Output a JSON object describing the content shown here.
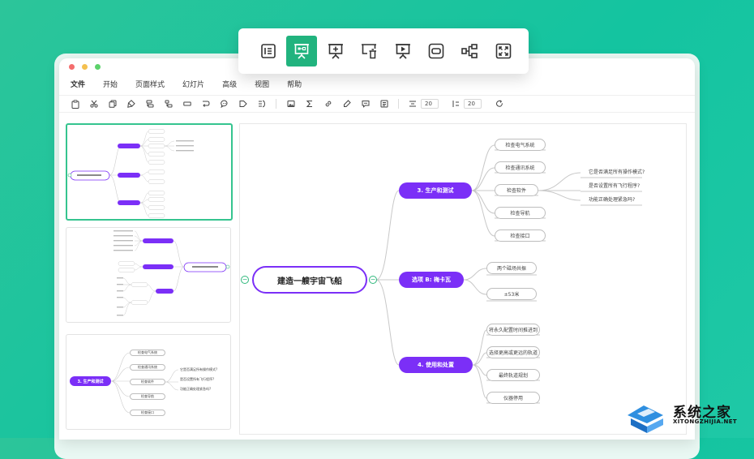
{
  "menu": [
    "文件",
    "开始",
    "页面样式",
    "幻灯片",
    "高级",
    "视图",
    "帮助"
  ],
  "toolbar": {
    "icons": [
      "clipboard-icon",
      "scissors-icon",
      "copy-icon",
      "format-brush-icon",
      "insert-subtopic-icon",
      "insert-topic-icon",
      "boundary-icon",
      "relationship-icon",
      "callout-icon",
      "tag-icon",
      "summary-icon",
      "image-icon",
      "formula-icon",
      "link-icon",
      "highlighter-icon",
      "comment-icon",
      "outline-icon"
    ],
    "spacing_h": "20",
    "spacing_v": "20"
  },
  "floating_toolbar": {
    "icons": [
      "outline-view-icon",
      "presentation-icon",
      "add-slide-icon",
      "delete-slide-icon",
      "play-slideshow-icon",
      "fit-slide-icon",
      "branch-slide-icon",
      "fullscreen-icon"
    ],
    "active_index": 1
  },
  "mindmap": {
    "root": "建造一艘宇宙飞船",
    "branches": [
      {
        "title": "3. 生产和测试",
        "children": [
          "检查电气系统",
          "检查通讯系统",
          "检查软件",
          "检查导航",
          "检查接口"
        ],
        "grandchildren": [
          "它是否满足所有操作模式?",
          "是否设置所有飞行程序?",
          "功能正确处理紧急吗?"
        ]
      },
      {
        "title": "选项 B: 梅卡瓦",
        "children": [
          "两个磁场共振",
          "±53米"
        ]
      },
      {
        "title": "4. 使用和处置",
        "children": [
          "将永久配置时间推进到",
          "选择更高或更远的轨道",
          "最终轨道规划",
          "仪器停用"
        ]
      }
    ]
  },
  "thumbnails": {
    "thumb3_main": "3. 生产和测试",
    "thumb3_children": [
      "检查电气系统",
      "检查通讯系统",
      "检查软件",
      "检查导航",
      "检查接口"
    ],
    "thumb3_grandchildren": [
      "它是否满足所有操作模式?",
      "是否设置所有飞行程序?",
      "功能正确处理紧急吗?"
    ]
  },
  "watermark": {
    "title": "系统之家",
    "url": "XITONGZHIJIA.NET"
  },
  "colors": {
    "accent": "#7b2ff7",
    "brand_green": "#21b37e",
    "background": "#1fc8a6"
  }
}
